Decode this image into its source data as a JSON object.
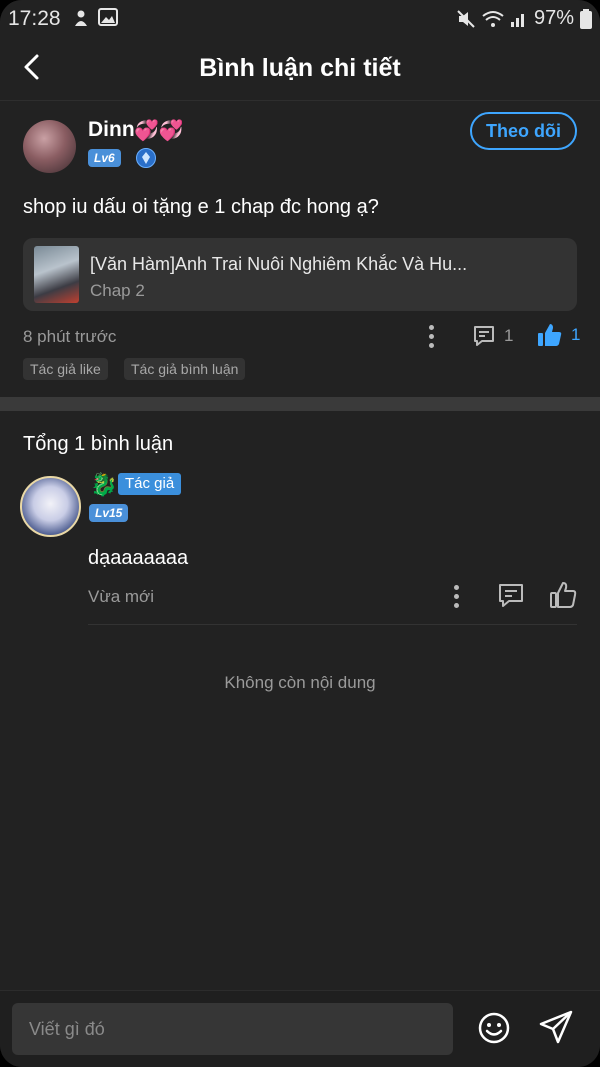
{
  "status_bar": {
    "time": "17:28",
    "battery": "97%"
  },
  "header": {
    "title": "Bình luận chi tiết"
  },
  "post": {
    "username": "Dinn",
    "username_emoji": "💞💞",
    "level": "Lv6",
    "follow_label": "Theo dõi",
    "text": "shop iu dấu oi tặng e 1 chap đc hong ạ?",
    "comic": {
      "title": "[Văn Hàm]Anh Trai Nuôi Nghiêm Khắc Và Hu...",
      "chapter": "Chap 2"
    },
    "time": "8 phút trước",
    "comment_count": "1",
    "like_count": "1",
    "tags": [
      "Tác giả like",
      "Tác giả bình luận"
    ]
  },
  "comments": {
    "total_label": "Tổng 1 bình luận",
    "items": [
      {
        "badge": "Tác giả",
        "level": "Lv15",
        "text": "dạaaaaaaa",
        "time": "Vừa mới"
      }
    ],
    "end_message": "Không còn nội dung"
  },
  "input": {
    "placeholder": "Viết gì đó"
  },
  "colors": {
    "accent": "#3ea6ff",
    "background": "#222222",
    "badge_blue": "#4a90d9"
  }
}
